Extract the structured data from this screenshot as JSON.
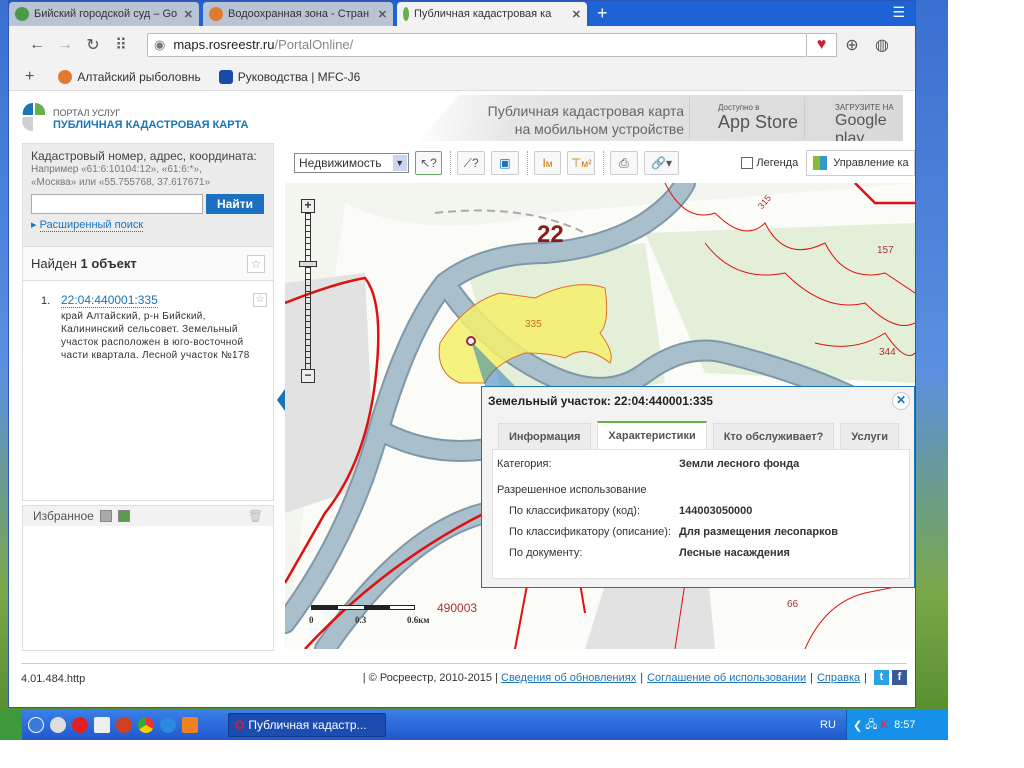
{
  "browser": {
    "tabs": [
      {
        "title": "Бийский городской суд – Go",
        "icon": "google-maps-icon",
        "active": false
      },
      {
        "title": "Водоохранная зона - Стран",
        "icon": "site-icon",
        "active": false
      },
      {
        "title": "Публичная кадастровая ка",
        "icon": "rosreestr-icon",
        "active": true
      }
    ],
    "url_host": "maps.rosreestr.ru",
    "url_path": "/PortalOnline/",
    "bookmarks": [
      {
        "label": "Алтайский рыболовнь"
      },
      {
        "label": "Руководства | MFC-J6"
      }
    ]
  },
  "header": {
    "portal": "ПОРТАЛ УСЛУГ",
    "title": "ПУБЛИЧНАЯ КАДАСТРОВАЯ КАРТА",
    "mobile_line1": "Публичная кадастровая карта",
    "mobile_line2": "на мобильном устройстве",
    "appstore_small": "Доступно в",
    "appstore": "App Store",
    "gplay_small": "ЗАГРУЗИТЕ НА",
    "gplay": "Google play"
  },
  "search": {
    "label": "Кадастровый номер, адрес, координата:",
    "hint1": "Например «61:6:10104:12», «61:6:*»,",
    "hint2": "«Москва» или «55.755768, 37.617671»",
    "value": "",
    "button": "Найти",
    "advanced": "Расширенный поиск"
  },
  "results": {
    "found_prefix": "Найден ",
    "found_count": "1 объект",
    "items": [
      {
        "num": "1.",
        "id": "22:04:440001:335",
        "desc": "край Алтайский, р-н Бийский, Калининский сельсовет. Земельный участок расположен в юго-восточной части квартала. Лесной участок №178"
      }
    ]
  },
  "favorites": {
    "label": "Избранное"
  },
  "toolbar": {
    "layer_select": "Недвижимость",
    "legend": "Легенда",
    "manage": "Управление ка"
  },
  "map": {
    "labels": {
      "region": "22",
      "parcel": "335",
      "n157": "157",
      "n344": "344",
      "n315": "315",
      "n66": "66",
      "n490003": "490003"
    },
    "scale": {
      "t0": "0",
      "t1": "0.3",
      "t2": "0.6км"
    },
    "colors": {
      "water": "#a9bfcc",
      "parcel": "#f4f06a",
      "boundary": "#e01010",
      "forest": "#e3efd8"
    }
  },
  "popup": {
    "title": "Земельный участок: 22:04:440001:335",
    "tabs": [
      "Информация",
      "Характеристики",
      "Кто обслуживает?",
      "Услуги"
    ],
    "active_tab": "Характеристики",
    "category_label": "Категория:",
    "category_value": "Земли лесного фонда",
    "permitted_label": "Разрешенное использование",
    "rows": [
      {
        "label": "По классификатору (код):",
        "value": "144003050000"
      },
      {
        "label": "По классификатору (описание):",
        "value": "Для размещения лесопарков"
      },
      {
        "label": "По документу:",
        "value": "Лесные насаждения"
      }
    ]
  },
  "footer": {
    "version": "4.01.484.http",
    "copyright": "| © Росреестр, 2010-2015 |",
    "links": [
      "Сведения об обновлениях",
      "Соглашение об использовании",
      "Справка"
    ]
  },
  "taskbar": {
    "task": "Публичная кадастр...",
    "lang": "RU",
    "time": "8:57"
  }
}
